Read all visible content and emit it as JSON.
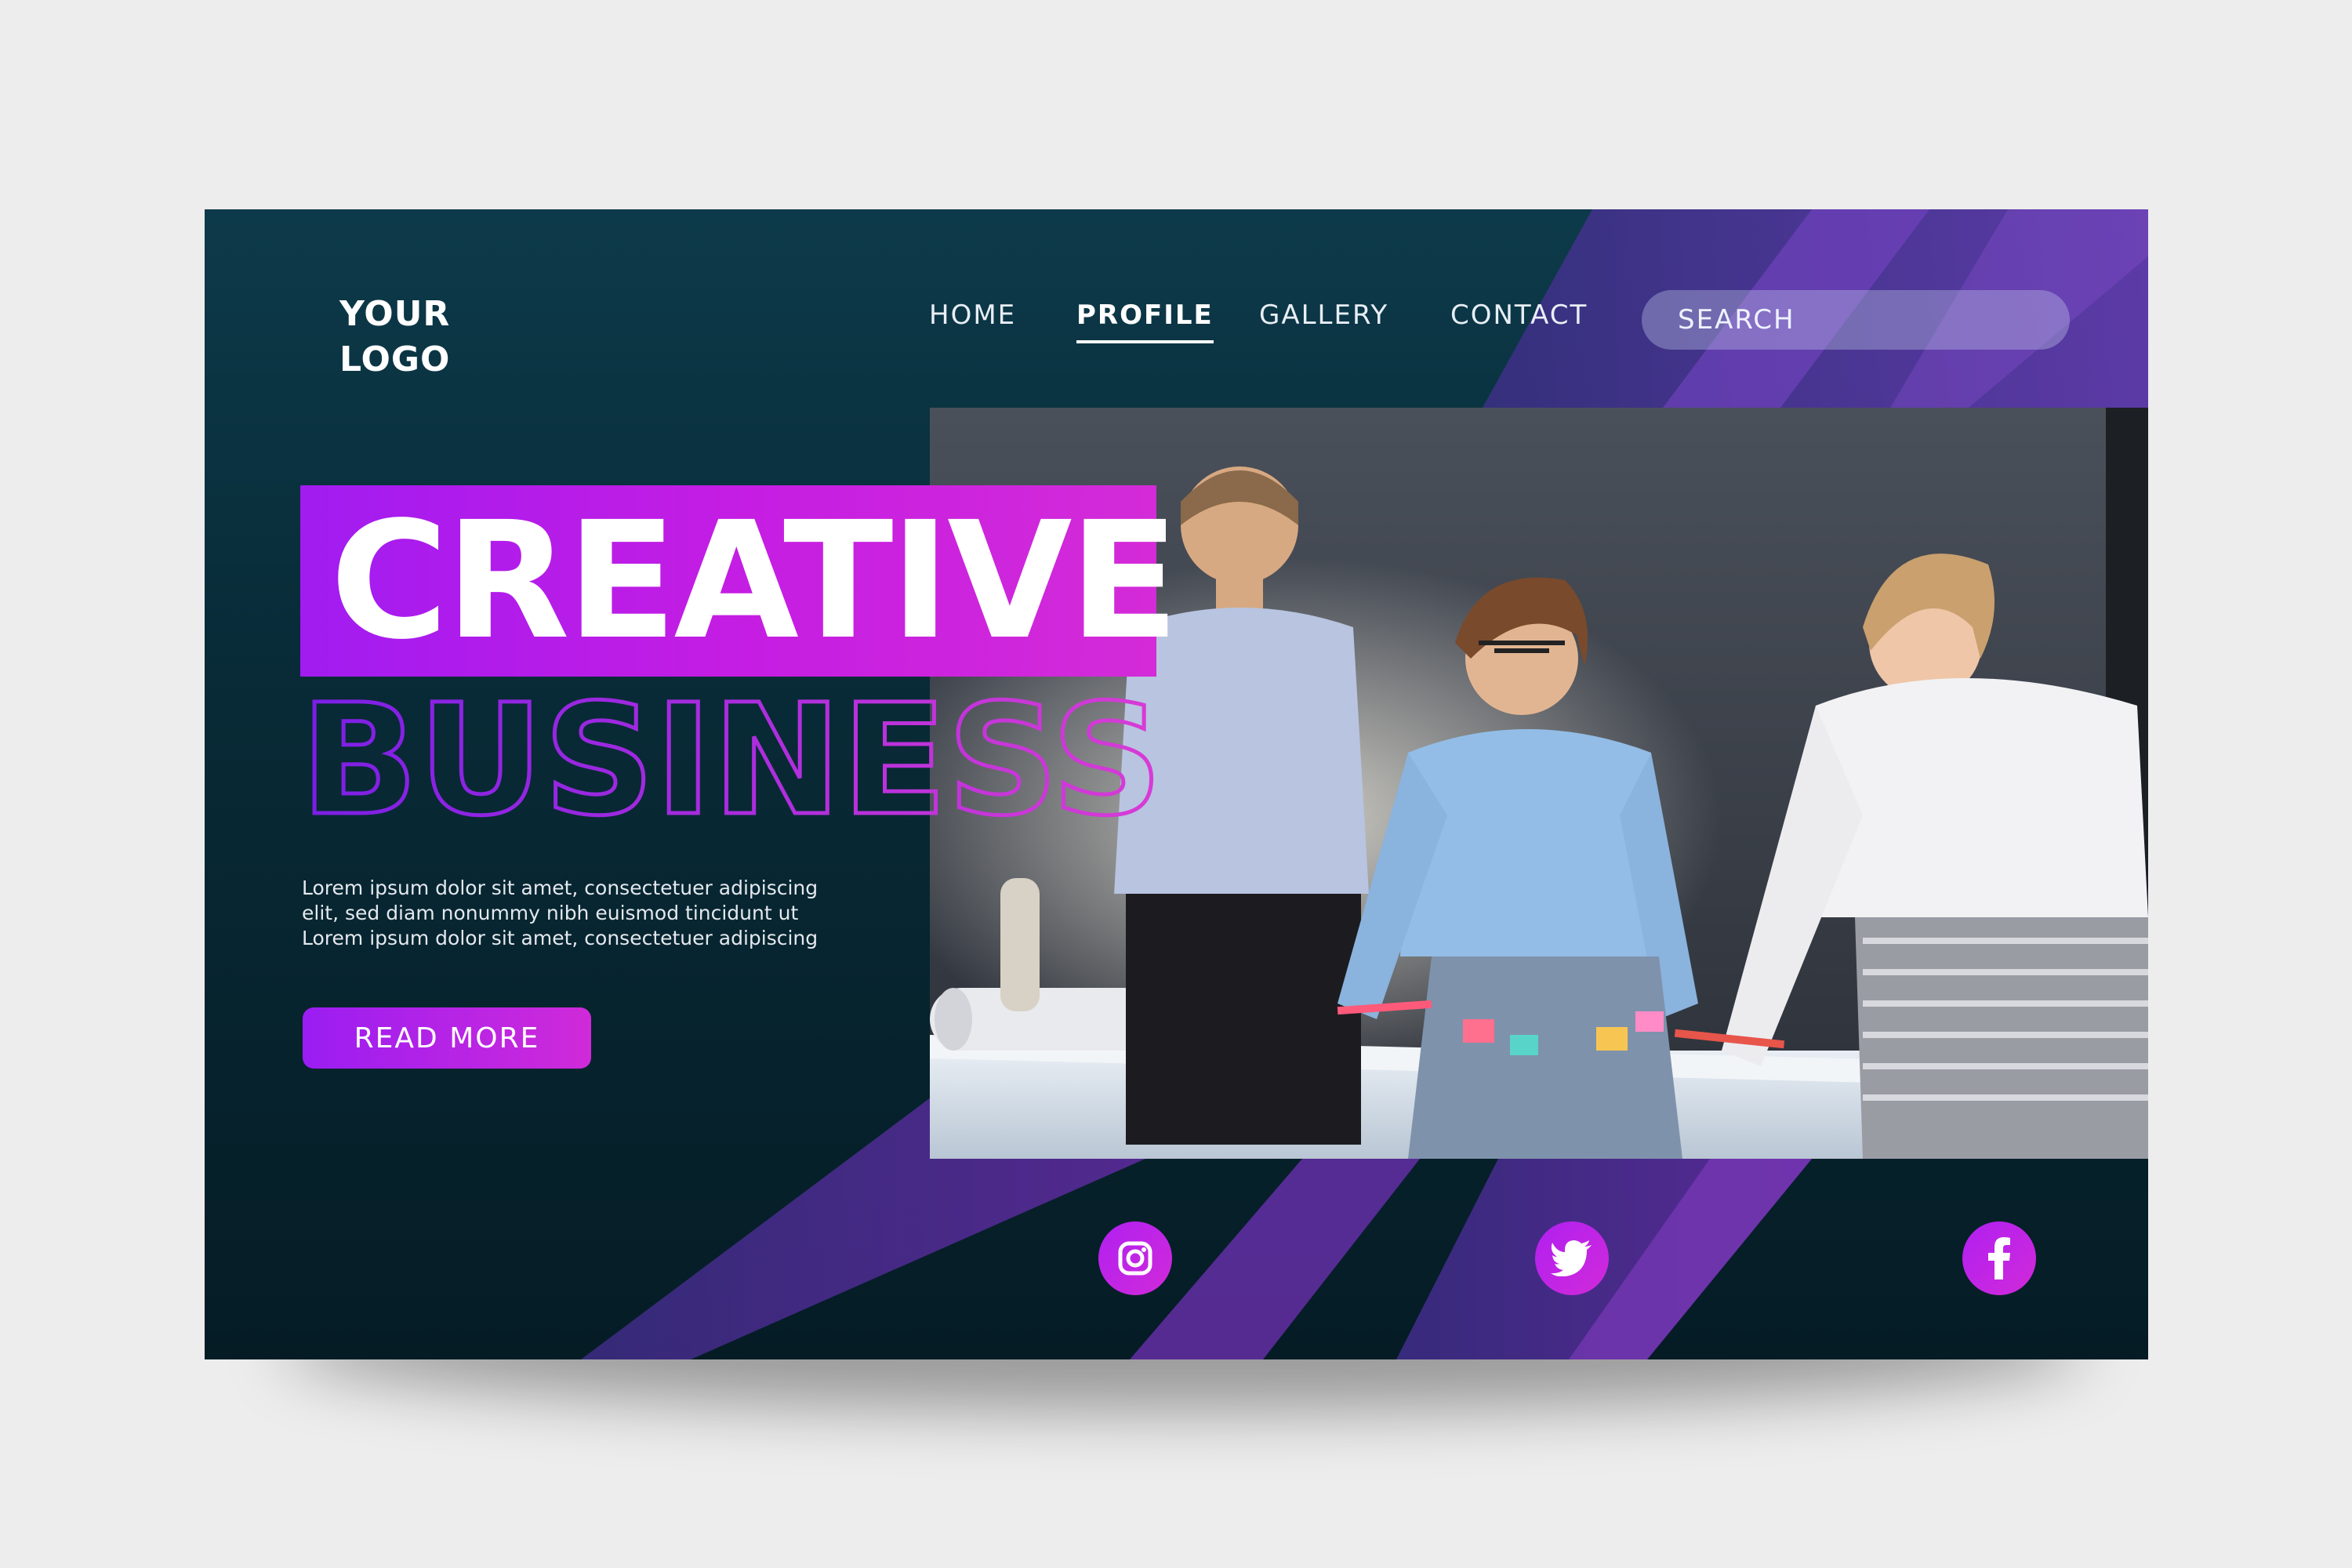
{
  "logo": {
    "text": "YOUR\nLOGO"
  },
  "nav": {
    "items": [
      {
        "label": "HOME",
        "active": false
      },
      {
        "label": "PROFILE",
        "active": true
      },
      {
        "label": "GALLERY",
        "active": false
      },
      {
        "label": "CONTACT",
        "active": false
      }
    ]
  },
  "search": {
    "placeholder": "SEARCH"
  },
  "hero": {
    "headline_1": "CREATIVE",
    "headline_2": "BUSINESS",
    "body": "Lorem ipsum dolor sit amet, consectetuer adipiscing\nelit, sed diam nonummy nibh euismod tincidunt ut\nLorem ipsum dolor sit amet, consectetuer adipiscing",
    "cta_label": "READ MORE"
  },
  "social": [
    {
      "icon": "instagram-icon"
    },
    {
      "icon": "twitter-icon"
    },
    {
      "icon": "facebook-icon"
    }
  ],
  "colors": {
    "background_top": "#0d3a4a",
    "background_bottom": "#051c25",
    "accent_purple": "#a11cf0",
    "accent_magenta": "#d42bd8",
    "page_bg": "#ededed"
  }
}
